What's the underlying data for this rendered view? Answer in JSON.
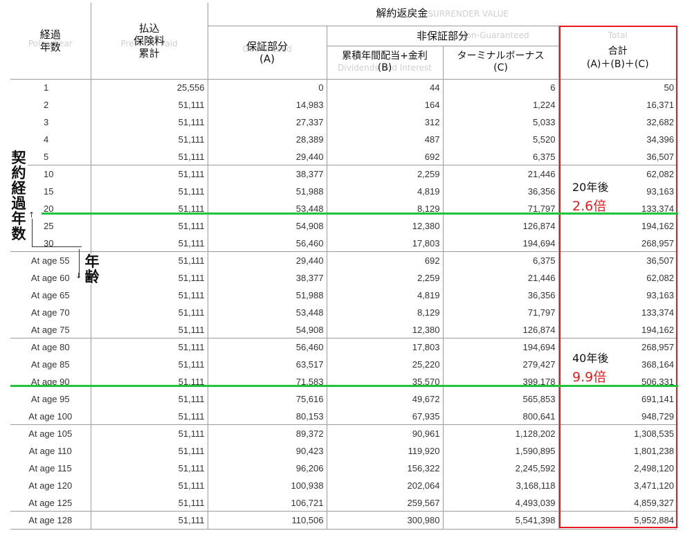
{
  "header": {
    "policy_year_jp": "経過\n年数",
    "policy_year_en": "Policy Year",
    "premium_jp": "払込\n保険料\n累計",
    "premium_en": "Premium Paid",
    "surrender_jp": "解約返戻金",
    "surrender_en": "SURRENDER VALUE",
    "guaranteed_jp": "保証部分",
    "guaranteed_letter": "(A)",
    "guaranteed_en": "Guaranteed",
    "non_guaranteed_jp": "非保証部分",
    "non_guaranteed_en": "Non-Guaranteed",
    "dividends_jp": "累積年間配当+金利",
    "dividends_letter": "(B)",
    "dividends_en": "Dividends and Interest",
    "terminal_jp": "ターミナルボーナス",
    "terminal_letter": "(C)",
    "total_jp": "合計",
    "total_formula": "(A)＋(B)＋(C)",
    "total_en": "Total"
  },
  "rows": [
    {
      "label": "1",
      "kind": "year",
      "premium": "25,556",
      "guaranteed": "0",
      "dividends": "44",
      "terminal": "6",
      "total": "50"
    },
    {
      "label": "2",
      "kind": "year",
      "premium": "51,111",
      "guaranteed": "14,983",
      "dividends": "164",
      "terminal": "1,224",
      "total": "16,371"
    },
    {
      "label": "3",
      "kind": "year",
      "premium": "51,111",
      "guaranteed": "27,337",
      "dividends": "312",
      "terminal": "5,033",
      "total": "32,682"
    },
    {
      "label": "4",
      "kind": "year",
      "premium": "51,111",
      "guaranteed": "28,389",
      "dividends": "487",
      "terminal": "5,520",
      "total": "34,396"
    },
    {
      "label": "5",
      "kind": "year",
      "premium": "51,111",
      "guaranteed": "29,440",
      "dividends": "692",
      "terminal": "6,375",
      "total": "36,507"
    },
    {
      "label": "10",
      "kind": "year",
      "premium": "51,111",
      "guaranteed": "38,377",
      "dividends": "2,259",
      "terminal": "21,446",
      "total": "62,082"
    },
    {
      "label": "15",
      "kind": "year",
      "premium": "51,111",
      "guaranteed": "51,988",
      "dividends": "4,819",
      "terminal": "36,356",
      "total": "93,163"
    },
    {
      "label": "20",
      "kind": "year",
      "premium": "51,111",
      "guaranteed": "53,448",
      "dividends": "8,129",
      "terminal": "71,797",
      "total": "133,374"
    },
    {
      "label": "25",
      "kind": "year",
      "premium": "51,111",
      "guaranteed": "54,908",
      "dividends": "12,380",
      "terminal": "126,874",
      "total": "194,162"
    },
    {
      "label": "30",
      "kind": "year",
      "premium": "51,111",
      "guaranteed": "56,460",
      "dividends": "17,803",
      "terminal": "194,694",
      "total": "268,957"
    },
    {
      "label": "At age 55",
      "kind": "age",
      "premium": "51,111",
      "guaranteed": "29,440",
      "dividends": "692",
      "terminal": "6,375",
      "total": "36,507"
    },
    {
      "label": "At age 60",
      "kind": "age",
      "premium": "51,111",
      "guaranteed": "38,377",
      "dividends": "2,259",
      "terminal": "21,446",
      "total": "62,082"
    },
    {
      "label": "At age 65",
      "kind": "age",
      "premium": "51,111",
      "guaranteed": "51,988",
      "dividends": "4,819",
      "terminal": "36,356",
      "total": "93,163"
    },
    {
      "label": "At age 70",
      "kind": "age",
      "premium": "51,111",
      "guaranteed": "53,448",
      "dividends": "8,129",
      "terminal": "71,797",
      "total": "133,374"
    },
    {
      "label": "At age 75",
      "kind": "age",
      "premium": "51,111",
      "guaranteed": "54,908",
      "dividends": "12,380",
      "terminal": "126,874",
      "total": "194,162"
    },
    {
      "label": "At age 80",
      "kind": "age",
      "premium": "51,111",
      "guaranteed": "56,460",
      "dividends": "17,803",
      "terminal": "194,694",
      "total": "268,957"
    },
    {
      "label": "At age 85",
      "kind": "age",
      "premium": "51,111",
      "guaranteed": "63,517",
      "dividends": "25,220",
      "terminal": "279,427",
      "total": "368,164"
    },
    {
      "label": "At age 90",
      "kind": "age",
      "premium": "51,111",
      "guaranteed": "71,583",
      "dividends": "35,570",
      "terminal": "399,178",
      "total": "506,331"
    },
    {
      "label": "At age 95",
      "kind": "age",
      "premium": "51,111",
      "guaranteed": "75,616",
      "dividends": "49,672",
      "terminal": "565,853",
      "total": "691,141"
    },
    {
      "label": "At age 100",
      "kind": "age",
      "premium": "51,111",
      "guaranteed": "80,153",
      "dividends": "67,935",
      "terminal": "800,641",
      "total": "948,729"
    },
    {
      "label": "At age 105",
      "kind": "age",
      "premium": "51,111",
      "guaranteed": "89,372",
      "dividends": "90,961",
      "terminal": "1,128,202",
      "total": "1,308,535"
    },
    {
      "label": "At age 110",
      "kind": "age",
      "premium": "51,111",
      "guaranteed": "90,423",
      "dividends": "119,920",
      "terminal": "1,590,895",
      "total": "1,801,238"
    },
    {
      "label": "At age 115",
      "kind": "age",
      "premium": "51,111",
      "guaranteed": "96,206",
      "dividends": "156,322",
      "terminal": "2,245,592",
      "total": "2,498,120"
    },
    {
      "label": "At age 120",
      "kind": "age",
      "premium": "51,111",
      "guaranteed": "100,938",
      "dividends": "202,064",
      "terminal": "3,168,118",
      "total": "3,471,120"
    },
    {
      "label": "At age 125",
      "kind": "age",
      "premium": "51,111",
      "guaranteed": "106,721",
      "dividends": "259,567",
      "terminal": "4,493,039",
      "total": "4,859,327"
    },
    {
      "label": "At age 128",
      "kind": "age",
      "premium": "51,111",
      "guaranteed": "110,506",
      "dividends": "300,980",
      "terminal": "5,541,398",
      "total": "5,952,884"
    }
  ],
  "group_starts": [
    5,
    10,
    15,
    20,
    25
  ],
  "annotations": {
    "policy_years_vertical": "契約経過年数",
    "age_vertical": "年齢",
    "note_20_label": "20年後",
    "note_20_value": "2.6倍",
    "note_40_label": "40年後",
    "note_40_value": "9.9倍",
    "highlight_color": "#e8191c",
    "line_color": "#1ec43a"
  }
}
